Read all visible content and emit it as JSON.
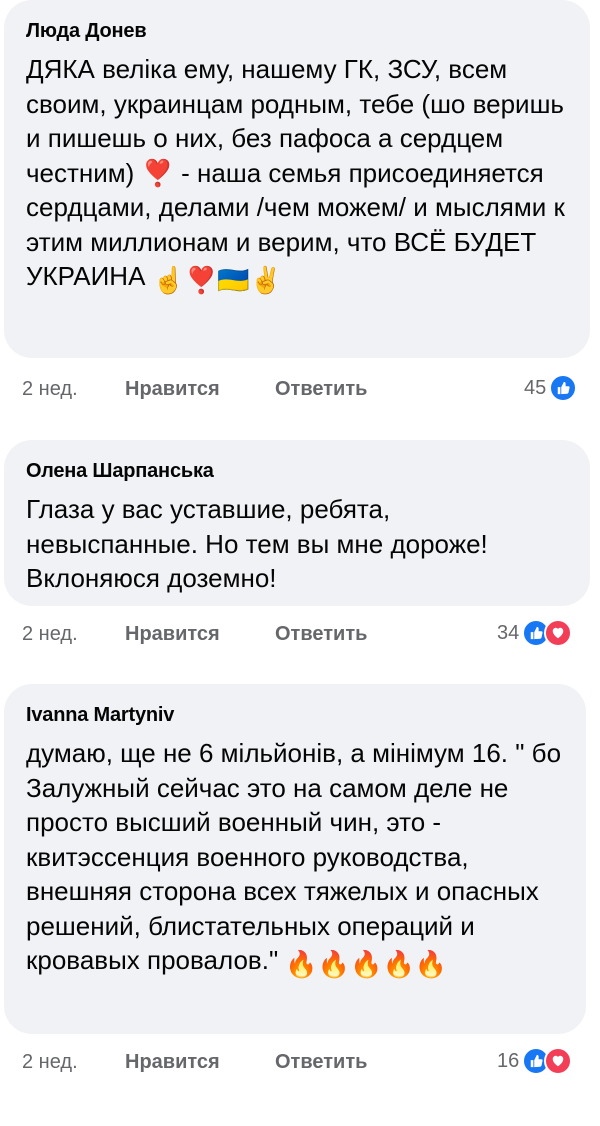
{
  "comments": [
    {
      "author": "Люда Донев",
      "text": "ДЯКА веліка ему, нашему ГК, ЗСУ, всем своим, украинцам родным, тебе (шо веришь и пишешь о них, без пафоса а сердцем честним) ❣️ - наша семья присоединяется сердцами, делами /чем можем/ и мыслями к этим миллионам и верим, что ВСЁ БУДЕТ УКРАИНА",
      "emojis": "☝️❣️🇺🇦✌️",
      "time": "2 нед.",
      "like_label": "Нравится",
      "reply_label": "Ответить",
      "reaction_count": "45",
      "reactions": [
        "like-icon"
      ]
    },
    {
      "author": "Олена Шарпанська",
      "text": "Глаза у вас уставшие, ребята, невыспанные. Но тем вы мне дороже! Вклоняюся доземно!",
      "emojis": "",
      "time": "2 нед.",
      "like_label": "Нравится",
      "reply_label": "Ответить",
      "reaction_count": "34",
      "reactions": [
        "like-icon",
        "love-icon"
      ]
    },
    {
      "author": "Ivanna Martyniv",
      "text": "думаю, ще не 6 мільйонів, а мінімум 16. \" бо Залужный сейчас это на самом деле не просто высший военный чин, это - квитэссенция военного руководства, внешняя сторона всех тяжелых и опасных решений, блистательных операций и кровавых провалов.\"",
      "emojis": "🔥🔥🔥🔥🔥",
      "time": "2 нед.",
      "like_label": "Нравится",
      "reply_label": "Ответить",
      "reaction_count": "16",
      "reactions": [
        "like-icon",
        "love-icon"
      ]
    }
  ],
  "colors": {
    "bubble": "#f0f2f5",
    "meta_text": "#65676b",
    "like_blue": "#1877f2",
    "love_red": "#f33e58"
  }
}
